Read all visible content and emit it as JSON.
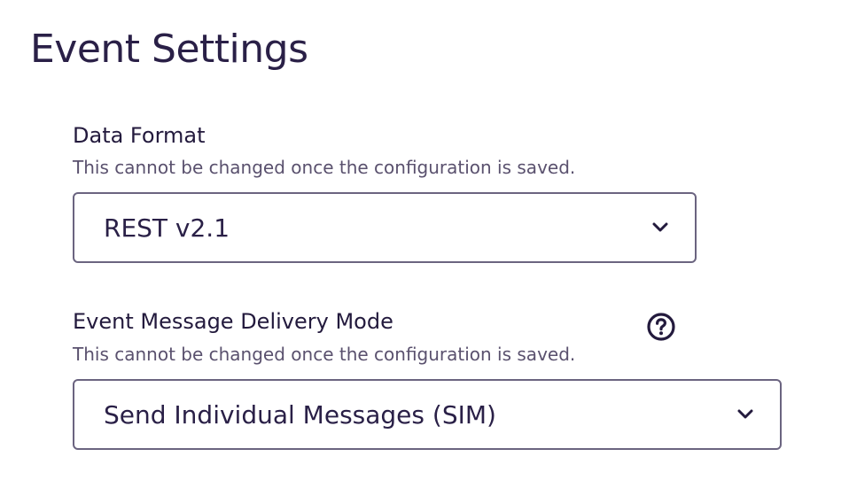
{
  "page": {
    "title": "Event Settings"
  },
  "data_format": {
    "label": "Data Format",
    "help_text": "This cannot be changed once the configuration is saved.",
    "selected_value": "REST v2.1",
    "chevron_icon": "chevron-down-icon"
  },
  "delivery_mode": {
    "label": "Event Message Delivery Mode",
    "help_text": "This cannot be changed once the configuration is saved.",
    "selected_value": "Send Individual Messages (SIM)",
    "chevron_icon": "chevron-down-icon",
    "help_icon": "question-circle-icon"
  },
  "colors": {
    "text_primary": "#231a3d",
    "text_secondary": "#5a516e",
    "border": "#6b6480"
  }
}
